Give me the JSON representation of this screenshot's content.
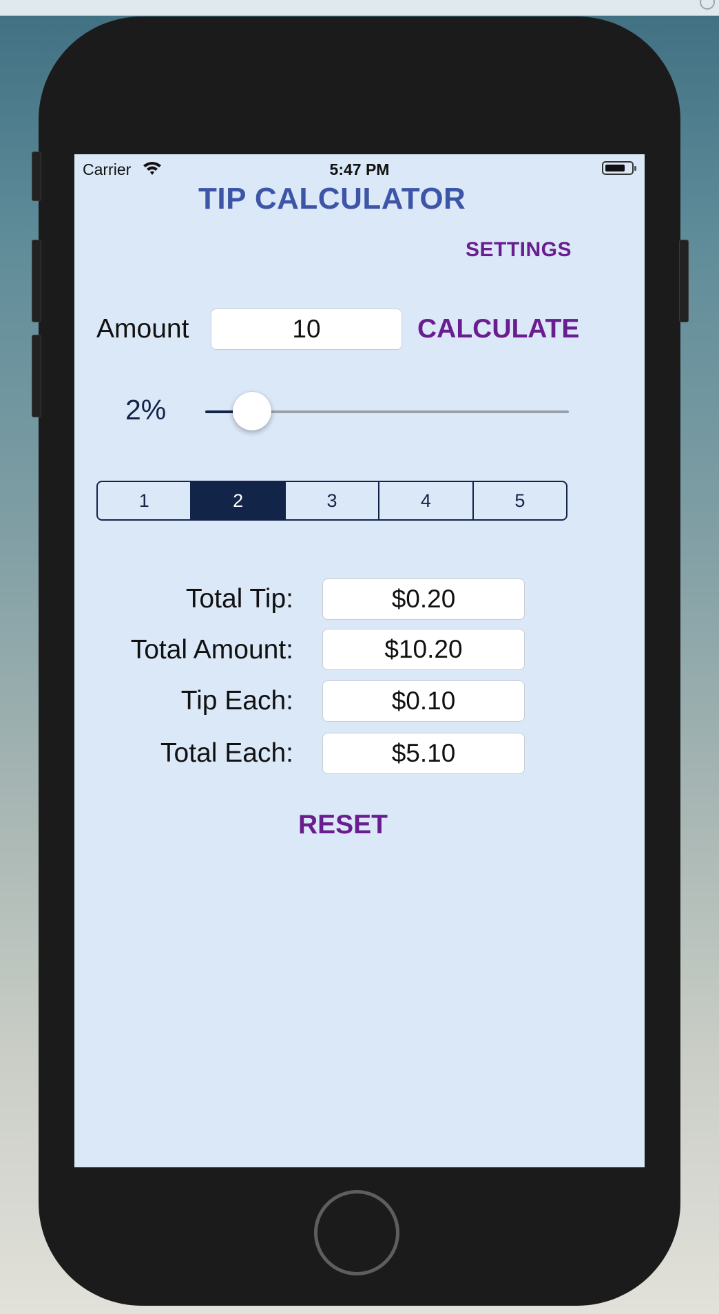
{
  "status_bar": {
    "carrier": "Carrier",
    "time": "5:47 PM"
  },
  "app": {
    "title": "TIP CALCULATOR",
    "settings_label": "SETTINGS",
    "amount_label": "Amount",
    "amount_value": "10",
    "calculate_label": "CALCULATE",
    "tip_percent_label": "2%",
    "tip_slider_fraction": 0.02,
    "split_options": [
      "1",
      "2",
      "3",
      "4",
      "5"
    ],
    "split_selected": "2",
    "results": {
      "total_tip": {
        "label": "Total Tip:",
        "value": "$0.20"
      },
      "total_amount": {
        "label": "Total Amount:",
        "value": "$10.20"
      },
      "tip_each": {
        "label": "Tip Each:",
        "value": "$0.10"
      },
      "total_each": {
        "label": "Total Each:",
        "value": "$5.10"
      }
    },
    "reset_label": "RESET"
  },
  "icons": [
    "wifi-icon",
    "battery-icon"
  ],
  "colors": {
    "screen_background": "#dbe8f8",
    "title": "#3d55a7",
    "action": "#6a1d8f",
    "dark_navy": "#132449",
    "phone_body": "#1b1b1c"
  }
}
